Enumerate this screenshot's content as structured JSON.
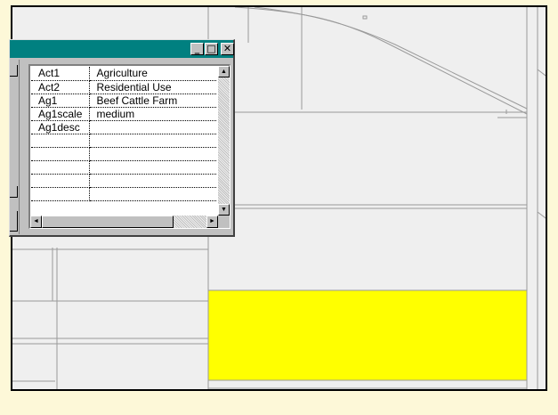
{
  "window": {
    "title": "",
    "buttons": {
      "minimize": "_",
      "maximize": "□",
      "close": "✕"
    }
  },
  "attributes": [
    {
      "field": "Act1",
      "value": "Agriculture"
    },
    {
      "field": "Act2",
      "value": "Residential Use"
    },
    {
      "field": "Ag1",
      "value": "Beef Cattle Farm"
    },
    {
      "field": "Ag1scale",
      "value": "medium"
    },
    {
      "field": "Ag1desc",
      "value": ""
    },
    {
      "field": "",
      "value": ""
    },
    {
      "field": "",
      "value": ""
    },
    {
      "field": "",
      "value": ""
    },
    {
      "field": "",
      "value": ""
    },
    {
      "field": "",
      "value": ""
    }
  ],
  "icons": {
    "scroll_up": "▲",
    "scroll_down": "▼",
    "scroll_left": "◄",
    "scroll_right": "►"
  },
  "colors": {
    "selected_parcel": "#ffff00",
    "map_background": "#efefef",
    "title_bar": "#008080",
    "page_background": "#fdf8d8"
  }
}
